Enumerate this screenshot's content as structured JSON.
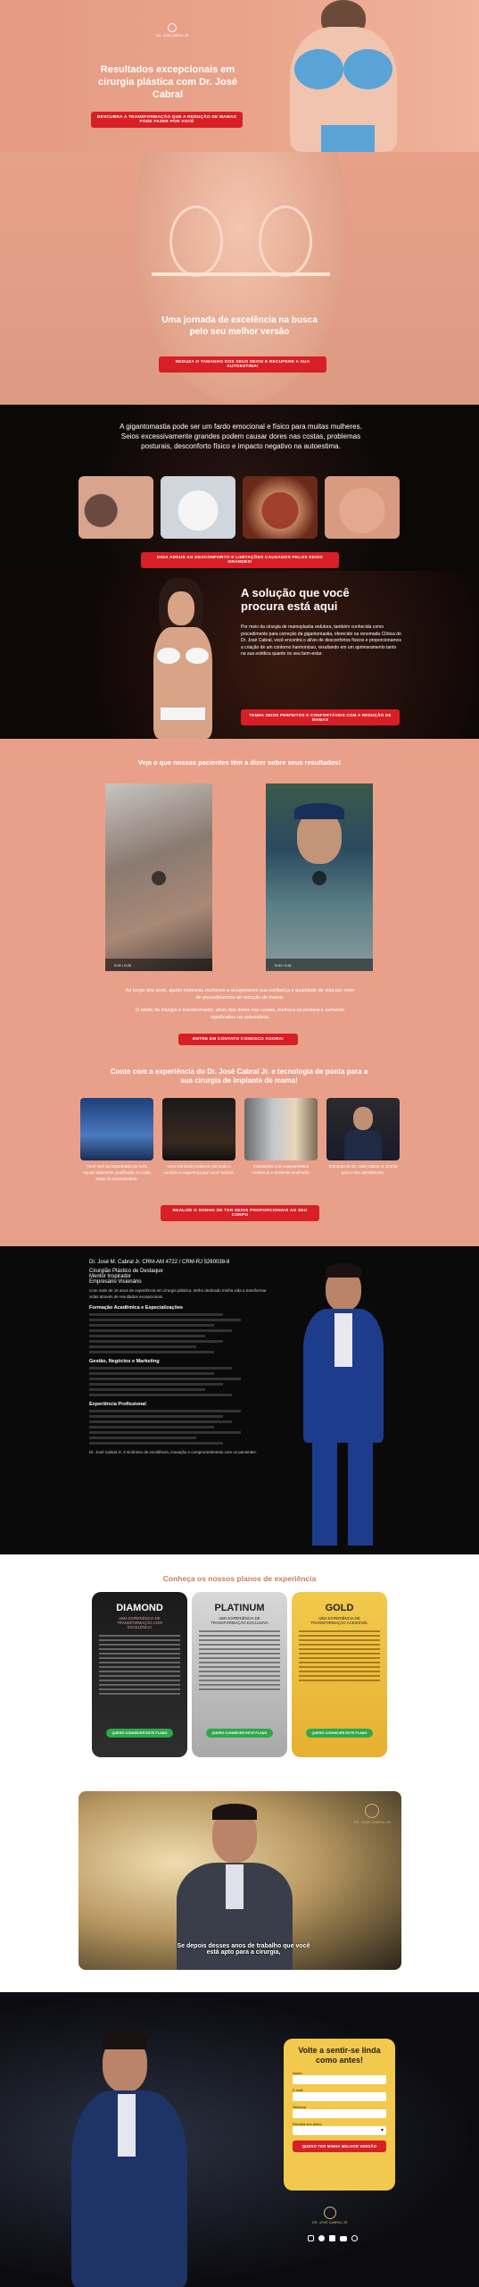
{
  "hero": {
    "logo_text": "DR. JOSÉ CABRAL JR",
    "title": "Resultados excepcionais em cirurgia plástica com Dr. José Cabral",
    "cta": "DESCUBRA A TRANSFORMAÇÃO QUE A REDUÇÃO DE MAMAS PODE FAZER POR VOCÊ"
  },
  "journey": {
    "title_line1": "Uma jornada de excelência na busca",
    "title_line2": "pelo seu melhor versão",
    "cta": "REDUZA O TAMANHO DOS SEUS SEIOS E RECUPERE A SUA AUTOESTIMA!"
  },
  "problem": {
    "text": "A gigantomastia pode ser um fardo emocional e físico para muitas mulheres. Seios excessivamente grandes podem causar dores nas costas, problemas posturais, desconforto físico e impacto negativo na autoestima.",
    "cta": "DIGA ADEUS AO DESCONFORTO E LIMITAÇÕES CAUSADOS PELOS SEIOS GRANDES!"
  },
  "solution": {
    "title": "A solução que você procura está aqui",
    "text": "Por meio da cirurgia de mamoplastia redutora, também conhecida como procedimento para correção da gigantomastia, oferecido na renomada Clínica do Dr. José Cabral, você encontra o alívio de desconfortos físicos e proporcionamos a criação de um contorno harmonioso, resultando em um aprimoramento tanto na sua estética quanto no seu bem-estar.",
    "cta": "TENHA SEIOS PERFEITOS E CONFORTÁVEIS COM A REDUÇÃO DE MAMAS"
  },
  "testimonials": {
    "title": "Veja o que nossas pacientes têm a dizer sobre seus resultados!",
    "video1_time": "0:00 / 0:26",
    "video2_time": "0:00 / 0:41",
    "text1": "Ao longo dos anos, ajudei inúmeras mulheres a recuperarem sua confiança e qualidade de vida por meio de procedimentos de redução de mama.",
    "text2": "O efeito da cirurgia é transformador, alívio das dores nas costas, melhora na postura e aumento significativo na autoestima.",
    "cta": "ENTRE EM CONTATO CONOSCO AGORA!"
  },
  "experience": {
    "title": "Conte com a experiência do Dr. José Cabral Jr. e tecnologia de ponta para a sua cirurgia de implante de mama!",
    "cards": [
      {
        "caption": "Você será acompanhada por uma equipe altamente qualificada em cada etapa do procedimento."
      },
      {
        "caption": "Uma estrutura moderna com todo o conforto e segurança que você merece."
      },
      {
        "caption": "Instalações com equipamentos modernos e ambiente acolhedor."
      },
      {
        "caption": "Estrutura do Dr. José Cabral Jr. pronta para o seu atendimento."
      }
    ],
    "cta": "REALIZE O SONHO DE TER SEIOS PROPORCIONAIS AO SEU CORPO"
  },
  "bio": {
    "name_line": "Dr. José M. Cabral Jr. CRM-AM 4722 / CRM-RJ 5260038-8",
    "roles": [
      "Cirurgião Plástico de Destaque",
      "Mentor Inspirador",
      "Empresário Visionário"
    ],
    "intro": "Com mais de 15 anos de experiência em cirurgia plástica, tenho dedicado minha vida a transformar vidas através de resultados excepcionais.",
    "section1": "Formação Acadêmica e Especializações",
    "section2": "Gestão, Negócios e Marketing",
    "section3": "Experiência Profissional",
    "closing": "Dr. José Cabral Jr. é sinônimo de excelência, inovação e comprometimento com os pacientes."
  },
  "plans": {
    "title": "Conheça os nossos planos de experiência",
    "items": [
      {
        "name": "DIAMOND",
        "subtitle": "UMA EXPERIÊNCIA DE TRANSFORMAÇÃO COM EXCELÊNCIA",
        "cta": "QUERO CONHECER ESTE PLANO"
      },
      {
        "name": "PLATINUM",
        "subtitle": "UMA EXPERIÊNCIA DE TRANSFORMAÇÃO EXCLUSIVA",
        "cta": "QUERO CONHECER ESTE PLANO"
      },
      {
        "name": "GOLD",
        "subtitle": "UMA EXPERIÊNCIA DE TRANSFORMAÇÃO ACESSÍVEL",
        "cta": "QUERO CONHECER ESTE PLANO"
      }
    ]
  },
  "video": {
    "subtitle": "Se depois desses anos de trabalho que você está apto para a cirurgia,",
    "logo_text": "DR. JOSÉ CABRAL JR"
  },
  "form": {
    "title": "Volte a sentir-se linda como antes!",
    "fields": [
      {
        "label": "Nome"
      },
      {
        "label": "E-mail"
      },
      {
        "label": "Telefone"
      },
      {
        "label": "Escolha seu plano"
      }
    ],
    "submit": "QUERO TER MINHA MELHOR VERSÃO"
  },
  "footer": {
    "logo_text": "DR. JOSÉ CABRAL JR",
    "social": [
      "instagram-icon",
      "facebook-icon",
      "tiktok-icon",
      "youtube-icon",
      "globe-icon"
    ]
  }
}
